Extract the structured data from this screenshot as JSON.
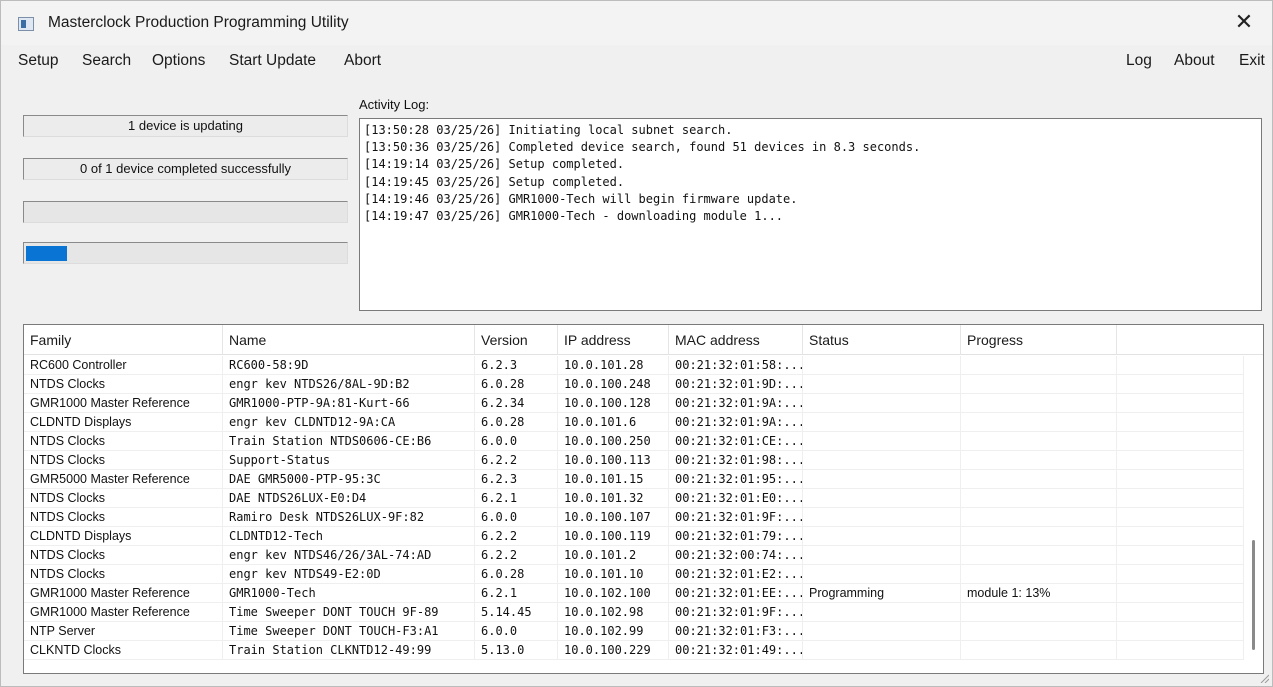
{
  "window": {
    "title": "Masterclock Production Programming Utility",
    "close_glyph": "✕"
  },
  "menu": {
    "left": [
      "Setup",
      "Search",
      "Options",
      "Start Update",
      "Abort"
    ],
    "right": [
      "Log",
      "About",
      "Exit"
    ]
  },
  "status": {
    "updating": "1 device is updating",
    "completed": "0 of 1 device completed successfully",
    "progress_fraction": 0.13,
    "accent_color": "#0a74d4"
  },
  "activity": {
    "label": "Activity Log:",
    "lines": [
      "[13:50:28 03/25/26] Initiating local subnet search.",
      "[13:50:36 03/25/26] Completed device search, found 51 devices in 8.3 seconds.",
      "[14:19:14 03/25/26] Setup completed.",
      "[14:19:45 03/25/26] Setup completed.",
      "[14:19:46 03/25/26] GMR1000-Tech will begin firmware update.",
      "[14:19:47 03/25/26] GMR1000-Tech - downloading module 1..."
    ]
  },
  "table": {
    "columns": [
      "Family",
      "Name",
      "Version",
      "IP address",
      "MAC address",
      "Status",
      "Progress"
    ],
    "rows": [
      [
        "RC600 Controller",
        "RC600-58:9D",
        "6.2.3",
        "10.0.101.28",
        "00:21:32:01:58:...",
        "",
        ""
      ],
      [
        "NTDS Clocks",
        "engr kev NTDS26/8AL-9D:B2",
        "6.0.28",
        "10.0.100.248",
        "00:21:32:01:9D:...",
        "",
        ""
      ],
      [
        "GMR1000 Master Reference",
        "GMR1000-PTP-9A:81-Kurt-66",
        "6.2.34",
        "10.0.100.128",
        "00:21:32:01:9A:...",
        "",
        ""
      ],
      [
        "CLDNTD Displays",
        "engr kev CLDNTD12-9A:CA",
        "6.0.28",
        "10.0.101.6",
        "00:21:32:01:9A:...",
        "",
        ""
      ],
      [
        "NTDS Clocks",
        "Train Station NTDS0606-CE:B6",
        "6.0.0",
        "10.0.100.250",
        "00:21:32:01:CE:...",
        "",
        ""
      ],
      [
        "NTDS Clocks",
        "Support-Status",
        "6.2.2",
        "10.0.100.113",
        "00:21:32:01:98:...",
        "",
        ""
      ],
      [
        "GMR5000 Master Reference",
        "DAE GMR5000-PTP-95:3C",
        "6.2.3",
        "10.0.101.15",
        "00:21:32:01:95:...",
        "",
        ""
      ],
      [
        "NTDS Clocks",
        "DAE NTDS26LUX-E0:D4",
        "6.2.1",
        "10.0.101.32",
        "00:21:32:01:E0:...",
        "",
        ""
      ],
      [
        "NTDS Clocks",
        "Ramiro Desk NTDS26LUX-9F:82",
        "6.0.0",
        "10.0.100.107",
        "00:21:32:01:9F:...",
        "",
        ""
      ],
      [
        "CLDNTD Displays",
        "CLDNTD12-Tech",
        "6.2.2",
        "10.0.100.119",
        "00:21:32:01:79:...",
        "",
        ""
      ],
      [
        "NTDS Clocks",
        "engr kev NTDS46/26/3AL-74:AD",
        "6.2.2",
        "10.0.101.2",
        "00:21:32:00:74:...",
        "",
        ""
      ],
      [
        "NTDS Clocks",
        "engr kev NTDS49-E2:0D",
        "6.0.28",
        "10.0.101.10",
        "00:21:32:01:E2:...",
        "",
        ""
      ],
      [
        "GMR1000 Master Reference",
        "GMR1000-Tech",
        "6.2.1",
        "10.0.102.100",
        "00:21:32:01:EE:...",
        "Programming",
        "module 1: 13%"
      ],
      [
        "GMR1000 Master Reference",
        "Time Sweeper DONT TOUCH 9F-89",
        "5.14.45",
        "10.0.102.98",
        "00:21:32:01:9F:...",
        "",
        ""
      ],
      [
        "NTP Server",
        "Time Sweeper DONT TOUCH-F3:A1",
        "6.0.0",
        "10.0.102.99",
        "00:21:32:01:F3:...",
        "",
        ""
      ],
      [
        "CLKNTD Clocks",
        "Train Station CLKNTD12-49:99",
        "5.13.0",
        "10.0.100.229",
        "00:21:32:01:49:...",
        "",
        ""
      ]
    ]
  }
}
